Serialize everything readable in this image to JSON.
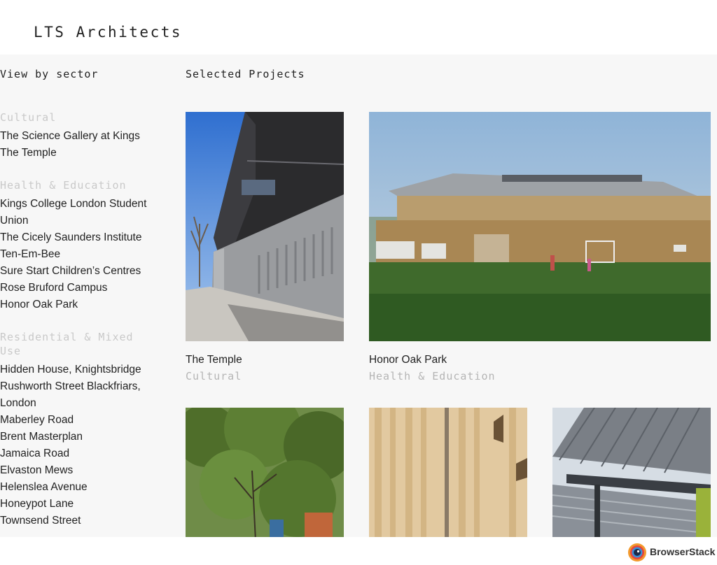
{
  "site": {
    "title": "LTS Architects"
  },
  "sidebar": {
    "heading": "View by sector",
    "groups": [
      {
        "title": "Cultural",
        "items": [
          "The Science Gallery at Kings",
          "The Temple"
        ]
      },
      {
        "title": "Health & Education",
        "items": [
          "Kings College London Student Union",
          "The Cicely Saunders Institute",
          "Ten-Em-Bee",
          "Sure Start Children’s Centres",
          "Rose Bruford Campus",
          "Honor Oak Park"
        ]
      },
      {
        "title": "Residential & Mixed Use",
        "items": [
          "Hidden House, Knightsbridge",
          "Rushworth Street Blackfriars, London",
          "Maberley Road",
          "Brent Masterplan",
          "Jamaica Road",
          "Elvaston Mews",
          "Helenslea Avenue",
          "Honeypot Lane",
          "Townsend Street"
        ]
      }
    ]
  },
  "main": {
    "heading": "Selected Projects",
    "projects": [
      {
        "title": "The Temple",
        "sector": "Cultural",
        "image": "dark-brick-building-photo"
      },
      {
        "title": "Honor Oak Park",
        "sector": "Health & Education",
        "image": "sports-pavilion-photo"
      },
      {
        "title": "",
        "sector": "",
        "image": "trees-photo"
      },
      {
        "title": "",
        "sector": "",
        "image": "timber-cladding-photo"
      },
      {
        "title": "",
        "sector": "",
        "image": "canopy-roof-photo"
      }
    ]
  },
  "footer": {
    "brand": "BrowserStack"
  }
}
